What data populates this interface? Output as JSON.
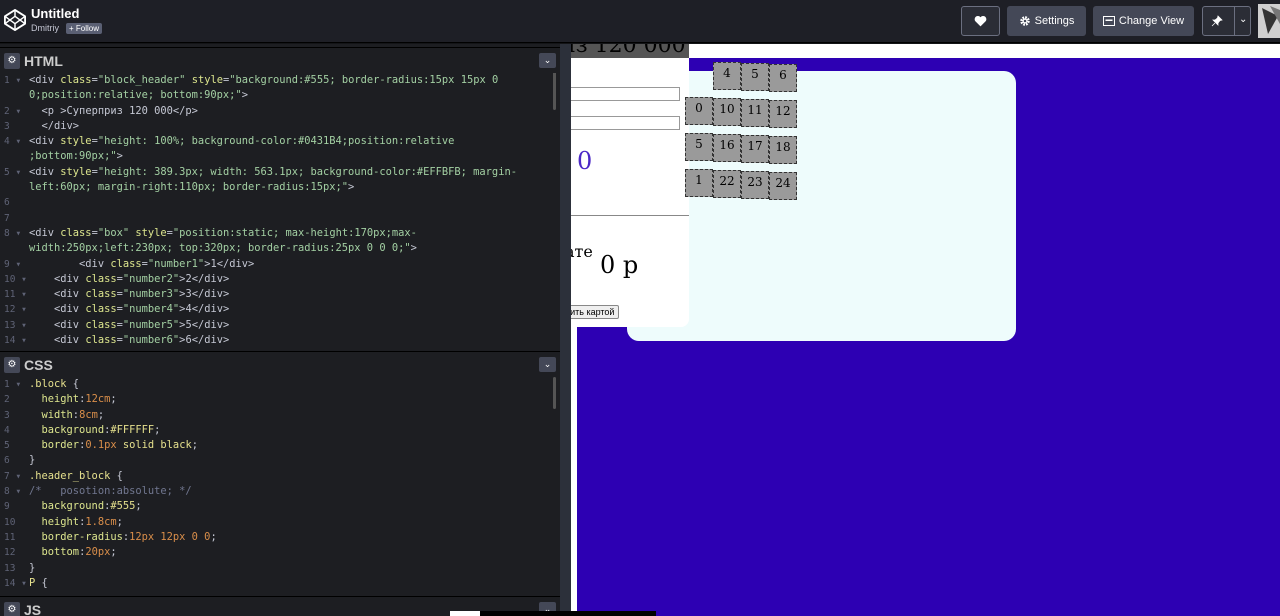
{
  "topbar": {
    "title": "Untitled",
    "author": "Dmitriy",
    "follow_label": "+ Follow",
    "settings_label": "Settings",
    "change_view_label": "Change View"
  },
  "html_pane": {
    "name": "HTML",
    "lines": [
      {
        "n": "1",
        "fold": true,
        "html": "<span class='t-tag'>&lt;div </span><span class='t-attr'>class</span>=<span class='t-str'>\"block_header\"</span> <span class='t-attr'>style</span>=<span class='t-str'>\"background:#555; border-radius:15px 15px 0</span>"
      },
      {
        "n": "",
        "fold": false,
        "html": "<span class='t-str'>0;position:relative; bottom:90px;\"</span><span class='t-tag'>&gt;</span>"
      },
      {
        "n": "2",
        "fold": true,
        "html": "  <span class='t-tag'>&lt;p &gt;</span>Суперприз 120 000<span class='t-tag'>&lt;/p&gt;</span>"
      },
      {
        "n": "3",
        "fold": false,
        "html": "  <span class='t-tag'>&lt;/div&gt;</span>"
      },
      {
        "n": "4",
        "fold": true,
        "html": "<span class='t-tag'>&lt;div </span><span class='t-attr'>style</span>=<span class='t-str'>\"height: 100%; background-color:#0431B4;position:relative</span>"
      },
      {
        "n": "",
        "fold": false,
        "html": "<span class='t-str'>;bottom:90px;\"</span><span class='t-tag'>&gt;</span>"
      },
      {
        "n": "5",
        "fold": true,
        "html": "<span class='t-tag'>&lt;div </span><span class='t-attr'>style</span>=<span class='t-str'>\"height: 389.3px; width: 563.1px; background-color:#EFFBFB; margin-</span>"
      },
      {
        "n": "",
        "fold": false,
        "html": "<span class='t-str'>left:60px; margin-right:110px; border-radius:15px;\"</span><span class='t-tag'>&gt;</span>"
      },
      {
        "n": "6",
        "fold": false,
        "html": ""
      },
      {
        "n": "7",
        "fold": false,
        "html": ""
      },
      {
        "n": "8",
        "fold": true,
        "html": "<span class='t-tag'>&lt;div </span><span class='t-attr'>class</span>=<span class='t-str'>\"box\"</span> <span class='t-attr'>style</span>=<span class='t-str'>\"position:static; max-height:170px;max-</span>"
      },
      {
        "n": "",
        "fold": false,
        "html": "<span class='t-str'>width:250px;left:230px; top:320px; border-radius:25px 0 0 0;\"</span><span class='t-tag'>&gt;</span>"
      },
      {
        "n": "9",
        "fold": true,
        "html": "        <span class='t-tag'>&lt;div </span><span class='t-attr'>class</span>=<span class='t-str'>\"number1\"</span><span class='t-tag'>&gt;</span>1<span class='t-tag'>&lt;/div&gt;</span>"
      },
      {
        "n": "10",
        "fold": true,
        "html": "    <span class='t-tag'>&lt;div </span><span class='t-attr'>class</span>=<span class='t-str'>\"number2\"</span><span class='t-tag'>&gt;</span>2<span class='t-tag'>&lt;/div&gt;</span>"
      },
      {
        "n": "11",
        "fold": true,
        "html": "    <span class='t-tag'>&lt;div </span><span class='t-attr'>class</span>=<span class='t-str'>\"number3\"</span><span class='t-tag'>&gt;</span>3<span class='t-tag'>&lt;/div&gt;</span>"
      },
      {
        "n": "12",
        "fold": true,
        "html": "    <span class='t-tag'>&lt;div </span><span class='t-attr'>class</span>=<span class='t-str'>\"number4\"</span><span class='t-tag'>&gt;</span>4<span class='t-tag'>&lt;/div&gt;</span>"
      },
      {
        "n": "13",
        "fold": true,
        "html": "    <span class='t-tag'>&lt;div </span><span class='t-attr'>class</span>=<span class='t-str'>\"number5\"</span><span class='t-tag'>&gt;</span>5<span class='t-tag'>&lt;/div&gt;</span>"
      },
      {
        "n": "14",
        "fold": true,
        "html": "    <span class='t-tag'>&lt;div </span><span class='t-attr'>class</span>=<span class='t-str'>\"number6\"</span><span class='t-tag'>&gt;</span>6<span class='t-tag'>&lt;/div&gt;</span>"
      }
    ]
  },
  "css_pane": {
    "name": "CSS",
    "lines": [
      {
        "n": "1",
        "fold": true,
        "html": "<span class='t-sel'>.block</span> {"
      },
      {
        "n": "2",
        "fold": false,
        "html": "  <span class='t-prop'>height</span>:<span class='t-num'>12cm</span>;"
      },
      {
        "n": "3",
        "fold": false,
        "html": "  <span class='t-prop'>width</span>:<span class='t-num'>8cm</span>;"
      },
      {
        "n": "4",
        "fold": false,
        "html": "  <span class='t-prop'>background</span>:<span class='t-sel'>#FFFFFF</span>;"
      },
      {
        "n": "5",
        "fold": false,
        "html": "  <span class='t-prop'>border</span>:<span class='t-num'>0.1px</span> <span class='t-sel'>solid</span> <span class='t-sel'>black</span>;"
      },
      {
        "n": "6",
        "fold": false,
        "html": "}"
      },
      {
        "n": "7",
        "fold": true,
        "html": "<span class='t-sel'>.header_block</span> {"
      },
      {
        "n": "8",
        "fold": true,
        "html": "<span class='t-cm'>/*   posotion:absolute; */</span>"
      },
      {
        "n": "9",
        "fold": false,
        "html": "  <span class='t-prop'>background</span>:<span class='t-sel'>#555</span>;"
      },
      {
        "n": "10",
        "fold": false,
        "html": "  <span class='t-prop'>height</span>:<span class='t-num'>1.8cm</span>;"
      },
      {
        "n": "11",
        "fold": false,
        "html": "  <span class='t-prop'>border-radius</span>:<span class='t-num'>12px 12px 0 0</span>;"
      },
      {
        "n": "12",
        "fold": false,
        "html": "  <span class='t-prop'>bottom</span>:<span class='t-num'>20px</span>;"
      },
      {
        "n": "13",
        "fold": false,
        "html": "}"
      },
      {
        "n": "14",
        "fold": true,
        "html": "<span class='t-sel'>P</span> {"
      }
    ]
  },
  "js_pane": {
    "name": "JS"
  },
  "preview": {
    "title_fragment": "из 120 000",
    "zero_value": "0",
    "pay_label_fragment": "ате",
    "sum_text": "0 р",
    "pay_button_fragment": "тить картой",
    "numbers": [
      "4",
      "5",
      "6",
      "0",
      "10",
      "11",
      "12",
      "5",
      "16",
      "17",
      "18",
      "1",
      "22",
      "23",
      "24"
    ]
  }
}
